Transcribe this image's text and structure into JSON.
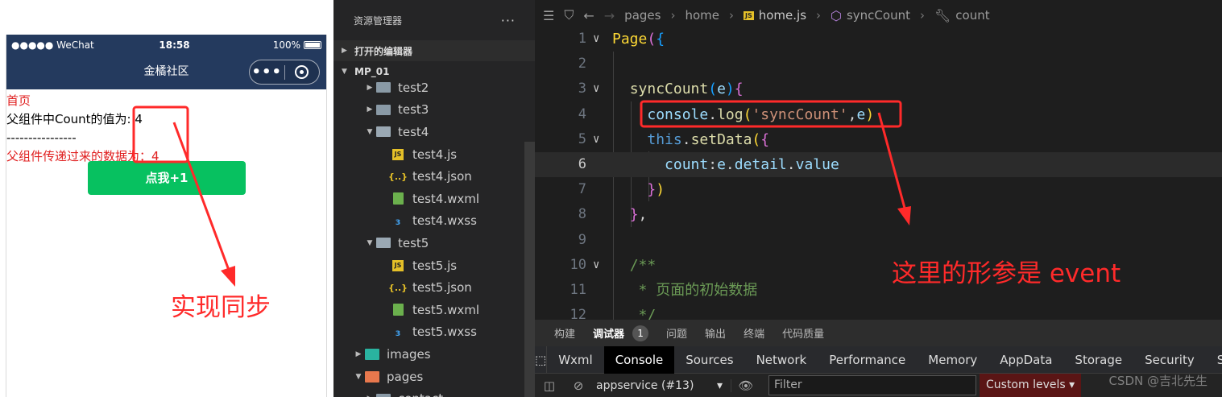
{
  "phone": {
    "status": {
      "carrier": "●●●●● WeChat",
      "wifi": "ᯤ",
      "time": "18:58",
      "battery": "100%"
    },
    "nav_title": "金橘社区",
    "capsule_more": "•••",
    "content": {
      "heading": "首页",
      "parent_count": "父组件中Count的值为: 4",
      "divider": "----------------",
      "child_value": "父组件传递过来的数据为：4",
      "button": "点我+1"
    }
  },
  "explorer": {
    "title": "资源管理器",
    "more": "···",
    "open_editors": "打开的编辑器",
    "project": "MP_01",
    "items": [
      {
        "label": "test2",
        "type": "folder",
        "indent": 1,
        "state": "closed"
      },
      {
        "label": "test3",
        "type": "folder",
        "indent": 1,
        "state": "closed"
      },
      {
        "label": "test4",
        "type": "folder",
        "indent": 1,
        "state": "open"
      },
      {
        "label": "test4.js",
        "type": "js",
        "indent": 2
      },
      {
        "label": "test4.json",
        "type": "json",
        "indent": 2
      },
      {
        "label": "test4.wxml",
        "type": "wxml",
        "indent": 2
      },
      {
        "label": "test4.wxss",
        "type": "wxss",
        "indent": 2
      },
      {
        "label": "test5",
        "type": "folder",
        "indent": 1,
        "state": "open"
      },
      {
        "label": "test5.js",
        "type": "js",
        "indent": 2
      },
      {
        "label": "test5.json",
        "type": "json",
        "indent": 2
      },
      {
        "label": "test5.wxml",
        "type": "wxml",
        "indent": 2
      },
      {
        "label": "test5.wxss",
        "type": "wxss",
        "indent": 2
      },
      {
        "label": "images",
        "type": "images",
        "indent": 0,
        "state": "closed"
      },
      {
        "label": "pages",
        "type": "pages",
        "indent": 0,
        "state": "open"
      },
      {
        "label": "contact",
        "type": "folder",
        "indent": 1,
        "state": "closed"
      }
    ]
  },
  "editor": {
    "breadcrumb": [
      "pages",
      "home",
      "home.js",
      "syncCount",
      "count"
    ],
    "active_line": 6
  },
  "devtools": {
    "top_tabs": [
      "构建",
      "调试器",
      "1",
      "问题",
      "输出",
      "终端",
      "代码质量"
    ],
    "panels": [
      "Wxml",
      "Console",
      "Sources",
      "Network",
      "Performance",
      "Memory",
      "AppData",
      "Storage",
      "Security",
      "Se"
    ],
    "active_panel": "Console",
    "context": "appservice (#13)",
    "filter_placeholder": "Filter",
    "levels": "Custom levels ▾"
  },
  "annotations": {
    "sync_label": "实现同步",
    "event_label": "这里的形参是 event",
    "color": "#ff2a2a"
  },
  "watermark": "CSDN @吉北先生"
}
